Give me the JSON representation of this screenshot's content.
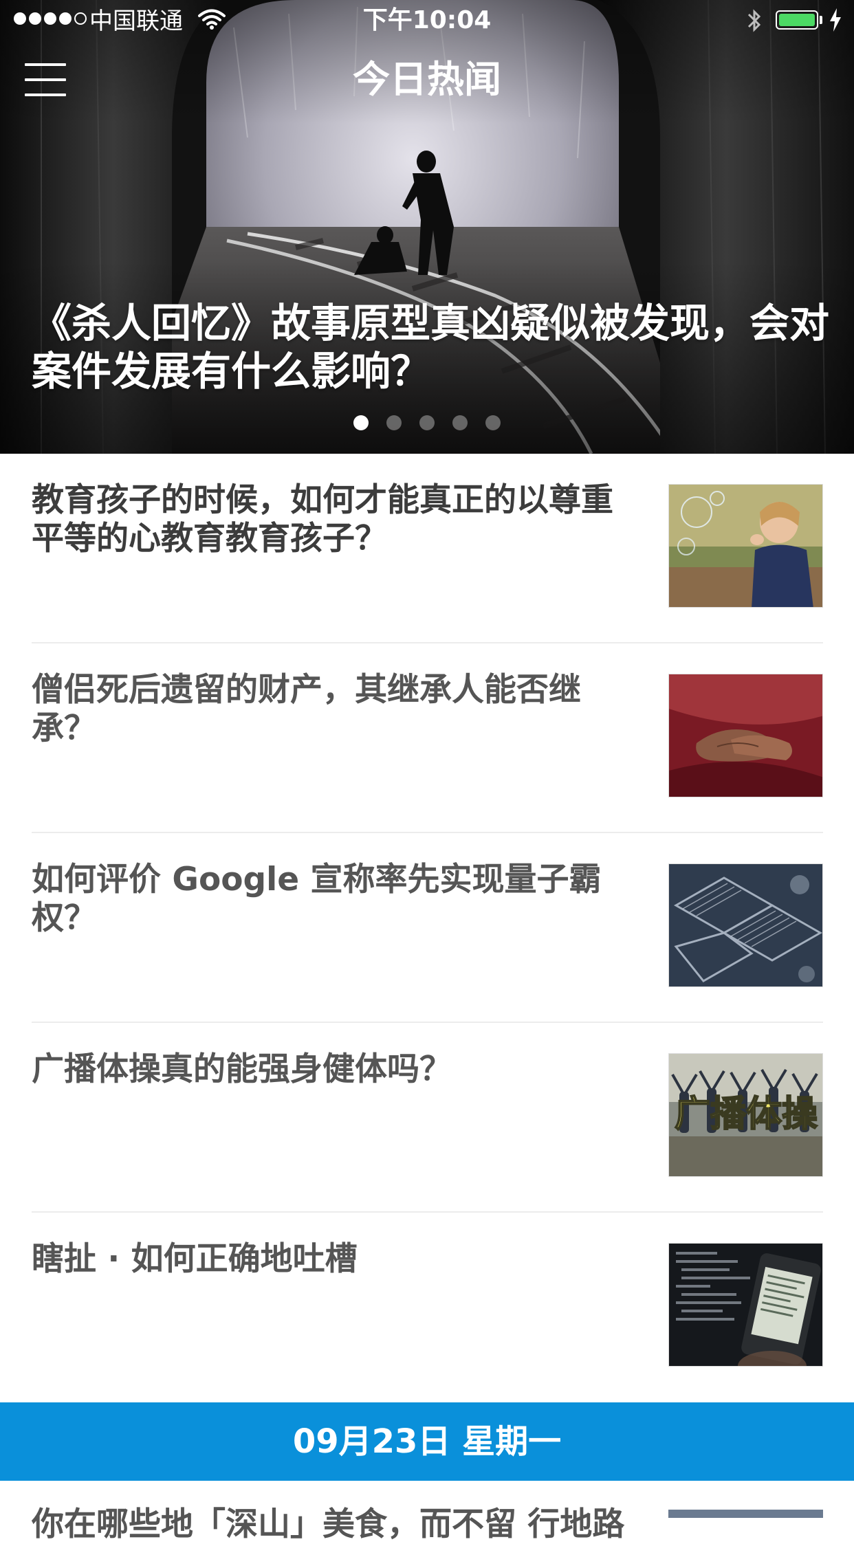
{
  "status_bar": {
    "carrier": "中国联通",
    "time": "下午10:04",
    "battery_level": 1.0
  },
  "nav": {
    "title": "今日热闻"
  },
  "hero": {
    "headline": "《杀人回忆》故事原型真凶疑似被发现，会对案件发展有什么影响？",
    "page_count": 5,
    "active_page": 1
  },
  "stories": [
    {
      "title": "教育孩子的时候，如何才能真正的以尊重平等的心教育教育孩子？",
      "thumb_icon": "child-bubbles-image"
    },
    {
      "title": "僧侣死后遗留的财产，其继承人能否继承？",
      "thumb_icon": "monk-hands-image"
    },
    {
      "title": "如何评价 Google 宣称率先实现量子霸权？",
      "thumb_icon": "quantum-chip-image"
    },
    {
      "title": "广播体操真的能强身健体吗？",
      "thumb_icon": "exercise-crowd-image",
      "thumb_caption": "广播体操"
    },
    {
      "title": "瞎扯 · 如何正确地吐槽",
      "thumb_icon": "phone-code-image"
    }
  ],
  "date_header": "09月23日 星期一",
  "next_story": {
    "title": "你在哪些地「深山」美食，而不留 行地路"
  },
  "colors": {
    "accent": "#0a90da",
    "title_text": "#3c3c3c",
    "read_text": "#555555",
    "battery": "#4cd964"
  }
}
